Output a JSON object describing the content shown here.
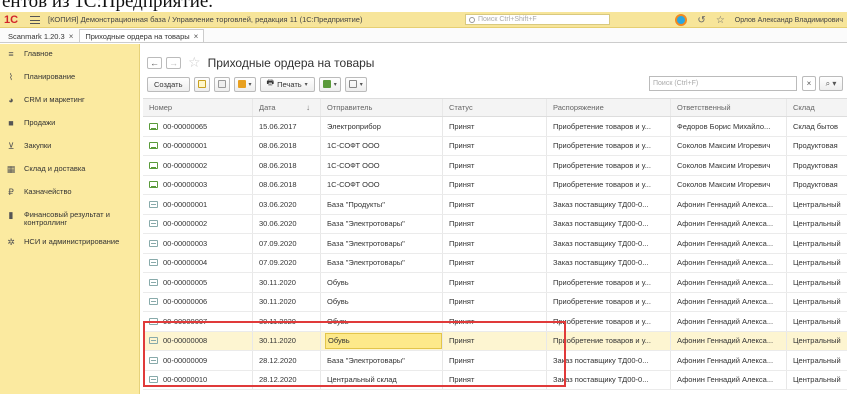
{
  "caption": "ентов из 1С:Предприятие.",
  "titlebar": {
    "logo": "1С",
    "app_title": "[КОПИЯ] Демонстрационная база / Управление торговлей, редакция 11  (1С:Предприятие)",
    "search_placeholder": "Поиск Ctrl+Shift+F",
    "user": "Орлов Александр Владимирович"
  },
  "tabs": [
    {
      "label": "Scanmark 1.20.3"
    },
    {
      "label": "Приходные ордера на товары"
    }
  ],
  "sidebar": {
    "items": [
      {
        "label": "Главное",
        "icon": "menu-lines-icon"
      },
      {
        "label": "Планирование",
        "icon": "chart-icon"
      },
      {
        "label": "CRM и маркетинг",
        "icon": "crm-icon"
      },
      {
        "label": "Продажи",
        "icon": "bag-icon"
      },
      {
        "label": "Закупки",
        "icon": "cart-icon"
      },
      {
        "label": "Склад и доставка",
        "icon": "warehouse-icon"
      },
      {
        "label": "Казначейство",
        "icon": "treasury-icon"
      },
      {
        "label": "Финансовый результат и контроллинг",
        "icon": "bar-chart-icon"
      },
      {
        "label": "НСИ и администрирование",
        "icon": "gear-icon"
      }
    ]
  },
  "page": {
    "title": "Приходные ордера на товары"
  },
  "toolbar": {
    "create_label": "Создать",
    "print_label": "Печать",
    "search_placeholder": "Поиск (Ctrl+F)"
  },
  "table": {
    "columns": [
      "Номер",
      "Дата",
      "Отправитель",
      "Статус",
      "Распоряжение",
      "Ответственный",
      "Склад"
    ],
    "rows": [
      {
        "num": "00-00000065",
        "date": "15.06.2017",
        "from": "Электроприбор",
        "status": "Принят",
        "order": "Приобретение товаров и у...",
        "resp": "Федоров Борис Михайло...",
        "store": "Склад бытов",
        "posted": true
      },
      {
        "num": "00-00000001",
        "date": "08.06.2018",
        "from": "1С-СОФТ ООО",
        "status": "Принят",
        "order": "Приобретение товаров и у...",
        "resp": "Соколов Максим Игоревич",
        "store": "Продуктовая",
        "posted": true
      },
      {
        "num": "00-00000002",
        "date": "08.06.2018",
        "from": "1С-СОФТ ООО",
        "status": "Принят",
        "order": "Приобретение товаров и у...",
        "resp": "Соколов Максим Игоревич",
        "store": "Продуктовая",
        "posted": true
      },
      {
        "num": "00-00000003",
        "date": "08.06.2018",
        "from": "1С-СОФТ ООО",
        "status": "Принят",
        "order": "Приобретение товаров и у...",
        "resp": "Соколов Максим Игоревич",
        "store": "Продуктовая",
        "posted": true
      },
      {
        "num": "00-00000001",
        "date": "03.06.2020",
        "from": "База \"Продукты\"",
        "status": "Принят",
        "order": "Заказ поставщику ТД00-0...",
        "resp": "Афонин Геннадий Алекса...",
        "store": "Центральный",
        "posted": false
      },
      {
        "num": "00-00000002",
        "date": "30.06.2020",
        "from": "База \"Электротовары\"",
        "status": "Принят",
        "order": "Заказ поставщику ТД00-0...",
        "resp": "Афонин Геннадий Алекса...",
        "store": "Центральный",
        "posted": false
      },
      {
        "num": "00-00000003",
        "date": "07.09.2020",
        "from": "База \"Электротовары\"",
        "status": "Принят",
        "order": "Заказ поставщику ТД00-0...",
        "resp": "Афонин Геннадий Алекса...",
        "store": "Центральный",
        "posted": false
      },
      {
        "num": "00-00000004",
        "date": "07.09.2020",
        "from": "База \"Электротовары\"",
        "status": "Принят",
        "order": "Заказ поставщику ТД00-0...",
        "resp": "Афонин Геннадий Алекса...",
        "store": "Центральный",
        "posted": false
      },
      {
        "num": "00-00000005",
        "date": "30.11.2020",
        "from": "Обувь",
        "status": "Принят",
        "order": "Приобретение товаров и у...",
        "resp": "Афонин Геннадий Алекса...",
        "store": "Центральный",
        "posted": false
      },
      {
        "num": "00-00000006",
        "date": "30.11.2020",
        "from": "Обувь",
        "status": "Принят",
        "order": "Приобретение товаров и у...",
        "resp": "Афонин Геннадий Алекса...",
        "store": "Центральный",
        "posted": false
      },
      {
        "num": "00-00000007",
        "date": "30.11.2020",
        "from": "Обувь",
        "status": "Принят",
        "order": "Приобретение товаров и у...",
        "resp": "Афонин Геннадий Алекса...",
        "store": "Центральный",
        "posted": false
      },
      {
        "num": "00-00000008",
        "date": "30.11.2020",
        "from": "Обувь",
        "status": "Принят",
        "order": "Приобретение товаров и у...",
        "resp": "Афонин Геннадий Алекса...",
        "store": "Центральный",
        "posted": false,
        "selected": true
      },
      {
        "num": "00-00000009",
        "date": "28.12.2020",
        "from": "База \"Электротовары\"",
        "status": "Принят",
        "order": "Заказ поставщику ТД00-0...",
        "resp": "Афонин Геннадий Алекса...",
        "store": "Центральный",
        "posted": false
      },
      {
        "num": "00-00000010",
        "date": "28.12.2020",
        "from": "Центральный склад",
        "status": "Принят",
        "order": "Заказ поставщику ТД00-0...",
        "resp": "Афонин Геннадий Алекса...",
        "store": "Центральный",
        "posted": false
      }
    ]
  },
  "colors": {
    "sidebar_bg": "#fbeaa0",
    "titlebar_bg": "#f7e59a",
    "selected_row": "#fdf5d1",
    "highlight_frame": "#e03a3a"
  }
}
